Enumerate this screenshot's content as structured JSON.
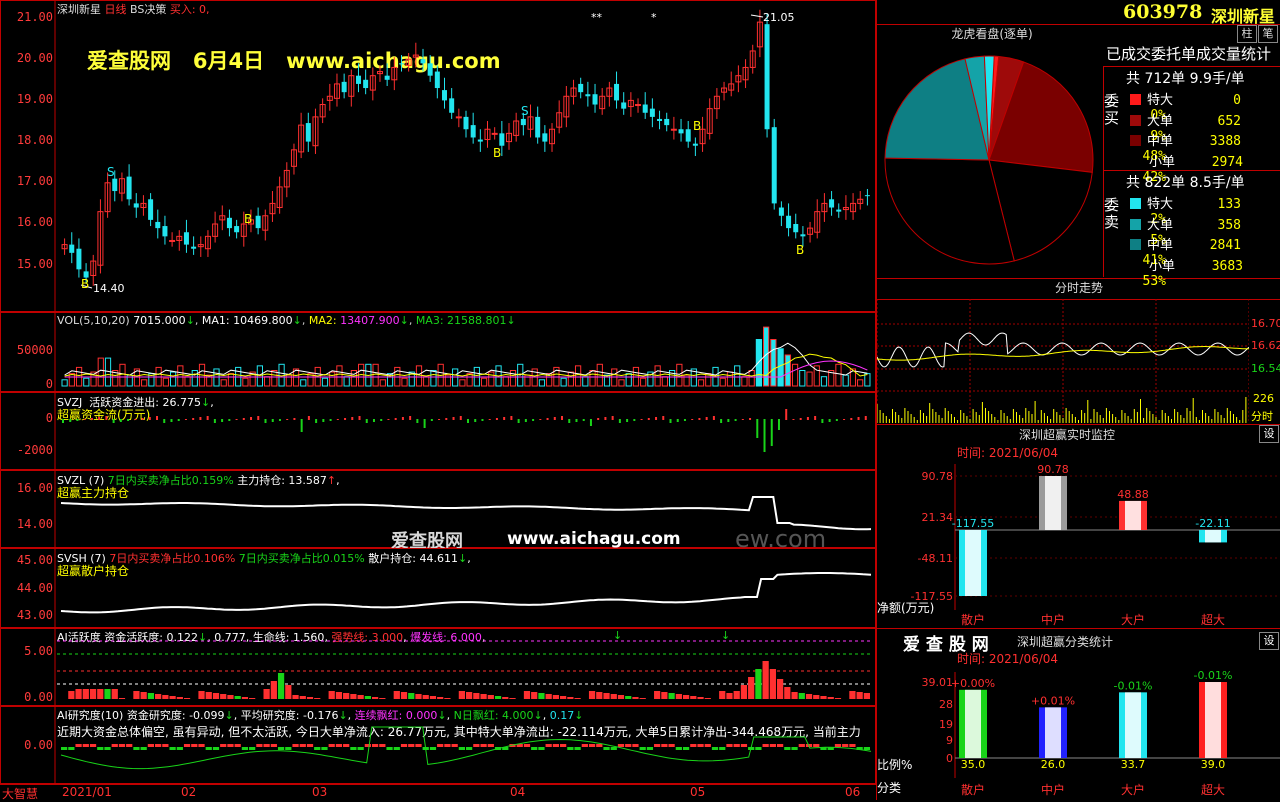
{
  "header": {
    "stock_name": "深圳新星",
    "period": "日线",
    "strategy": "BS决策",
    "buy_label": "买入: 0,",
    "code": "603978",
    "code_name": "深圳新星"
  },
  "watermarks": {
    "top": "爱查股网   6月4日   www.aichagu.com",
    "mid_cn": "爱查股网",
    "mid_url": "www.aichagu.com",
    "mid_faded": "ew.com",
    "right_brand": "爱 查 股 网"
  },
  "main_chart": {
    "y_ticks": [
      "21.00",
      "20.00",
      "19.00",
      "18.00",
      "17.00",
      "16.00",
      "15.00"
    ],
    "high_label": "21.05",
    "low_label": "14.40",
    "signal_s": "S",
    "signal_b": "B",
    "stars": [
      "**",
      "*"
    ]
  },
  "vol_panel": {
    "title": "VOL(5,10,20)",
    "vol": "7015.000",
    "ma1_label": "MA1:",
    "ma1": "10469.800",
    "ma2_label": "MA2:",
    "ma2": "13407.900",
    "ma3_label": "MA3:",
    "ma3": "21588.801",
    "y_ticks": [
      "50000",
      "0"
    ]
  },
  "svzj_panel": {
    "title": "SVZJ",
    "line": "活跃资金进出: 26.775",
    "subtitle": "超赢资金流(万元)",
    "y_ticks": [
      "0",
      "-2000"
    ]
  },
  "svzl_panel": {
    "title": "SVZL (7)",
    "ratio_label": "7日内买卖净占比",
    "ratio": "0.159%",
    "hold_label": "主力持仓:",
    "hold": "13.587",
    "subtitle": "超赢主力持仓",
    "y_ticks": [
      "16.00",
      "14.00"
    ]
  },
  "svsh_panel": {
    "title": "SVSH (7)",
    "ratio1_label": "7日内买卖净占比",
    "ratio1": "0.106%",
    "ratio2_label": "7日内买卖净占比",
    "ratio2": "0.015%",
    "hold_label": "散户持仓:",
    "hold": "44.611",
    "subtitle": "超赢散户持仓",
    "y_ticks": [
      "45.00",
      "44.00",
      "43.00"
    ]
  },
  "ai_active_panel": {
    "title": "AI活跃度",
    "act_label": "资金活跃度:",
    "act": "0.122",
    "act2": "0.777",
    "life_label": "生命线:",
    "life": "1.560",
    "strong_label": "强势线:",
    "strong": "3.000",
    "burst_label": "爆发线:",
    "burst": "6.000",
    "y_ticks": [
      "5.00",
      "0.00"
    ]
  },
  "ai_research_panel": {
    "title": "AI研究度(10)",
    "res_label": "资金研究度:",
    "res": "-0.099",
    "avg_label": "平均研究度:",
    "avg": "-0.176",
    "red_label": "连续飘红:",
    "red": "0.000",
    "nday_label": "N日飘红:",
    "nday": "4.000",
    "nday2": "0.17",
    "commentary": "近期大资金总体偏空, 虽有异动, 但不太活跃, 今日大单净流入: 26.77万元, 其中特大单净流出: -22.114万元, 大单5日累计净出-344.468万元, 当前主力",
    "y_ticks": [
      "0.00"
    ]
  },
  "x_axis": [
    "2021/01",
    "02",
    "03",
    "04",
    "05",
    "06"
  ],
  "bottom_left_label": "大智慧",
  "dragon_panel": {
    "title": "龙虎看盘(逐单)",
    "subtitle": "已成交委托单成交量统计",
    "btn_pin": "柱",
    "btn_pen": "笔",
    "buy_side_label": "委买",
    "sell_side_label": "委卖",
    "buy_total": "共 712单 9.9手/单",
    "sell_total": "共 822单 8.5手/单",
    "buy_rows": [
      {
        "name": "特大",
        "count": "0",
        "pct": "0%",
        "color": "#ff1a1a"
      },
      {
        "name": "大单",
        "count": "652",
        "pct": "9%",
        "color": "#9e0a0a"
      },
      {
        "name": "中单",
        "count": "3388",
        "pct": "48%",
        "color": "#7a0000"
      },
      {
        "name": "小单",
        "count": "2974",
        "pct": "42%",
        "color": "#000000"
      }
    ],
    "sell_rows": [
      {
        "name": "特大",
        "count": "133",
        "pct": "2%",
        "color": "#22e5ef"
      },
      {
        "name": "大单",
        "count": "358",
        "pct": "5%",
        "color": "#14a3a8"
      },
      {
        "name": "中单",
        "count": "2841",
        "pct": "41%",
        "color": "#0e7f84"
      },
      {
        "name": "小单",
        "count": "3683",
        "pct": "53%",
        "color": "#000000"
      }
    ]
  },
  "intraday_panel": {
    "title": "分时走势",
    "y_ticks": [
      "16.70",
      "16.62",
      "16.54"
    ],
    "vol_tick": "226",
    "vol_label": "分时"
  },
  "monitor_panel": {
    "title": "深圳超赢实时监控",
    "btn": "设",
    "time": "时间: 2021/06/04",
    "y_ticks": [
      "90.78",
      "21.34",
      "-48.11",
      "-117.55"
    ],
    "y_label": "净额(万元)",
    "bars": [
      {
        "name": "散户",
        "value": -117.55,
        "label": "-117.55",
        "color": "#22e5ef"
      },
      {
        "name": "中户",
        "value": 90.78,
        "label": "90.78",
        "color": "#9b9b9b"
      },
      {
        "name": "大户",
        "value": 48.88,
        "label": "48.88",
        "color": "#ff3030"
      },
      {
        "name": "超大",
        "value": -22.11,
        "label": "-22.11",
        "color": "#22e5ef"
      }
    ]
  },
  "category_panel": {
    "title": "深圳超赢分类统计",
    "btn": "设",
    "time": "时间: 2021/06/04",
    "y_ticks": [
      "39.01",
      "28",
      "19",
      "9",
      "0"
    ],
    "ratio_label": "比例%",
    "cat_label": "分类",
    "bars": [
      {
        "name": "散户",
        "value": 35.0,
        "label": "35.0",
        "delta": "+0.00%",
        "color": "#19d419"
      },
      {
        "name": "中户",
        "value": 26.0,
        "label": "26.0",
        "delta": "+0.01%",
        "color": "#2222ff"
      },
      {
        "name": "大户",
        "value": 33.7,
        "label": "33.7",
        "delta": "-0.01%",
        "color": "#22e5ef"
      },
      {
        "name": "超大",
        "value": 39.0,
        "label": "39.0",
        "delta": "-0.01%",
        "color": "#ff2020"
      }
    ]
  },
  "colors": {
    "up": "#ff3030",
    "down": "#22e5ef",
    "border": "#c00000",
    "yellow": "#ffff00",
    "white": "#ffffff",
    "magenta": "#ff33ff",
    "green": "#19d419"
  }
}
